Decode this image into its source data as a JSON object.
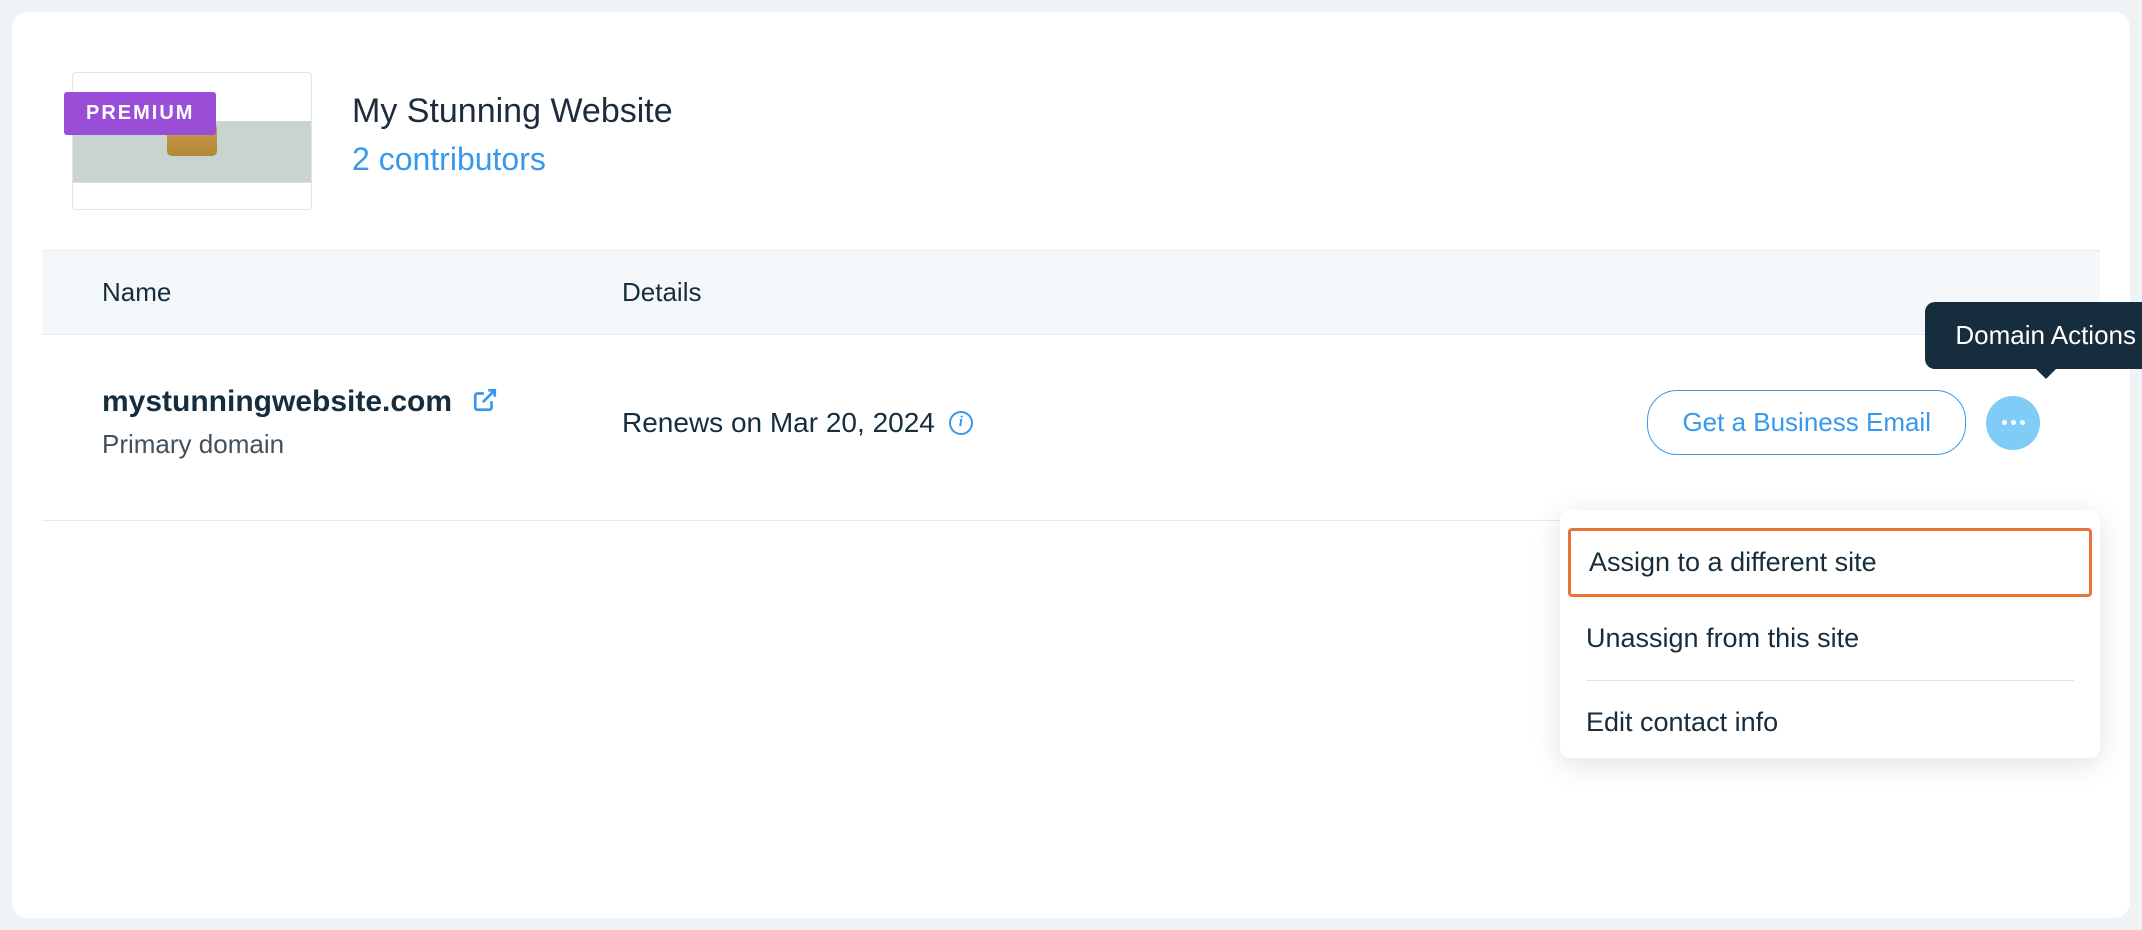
{
  "site": {
    "badge": "PREMIUM",
    "title": "My Stunning Website",
    "contributors_label": "2 contributors"
  },
  "table": {
    "columns": {
      "name": "Name",
      "details": "Details"
    }
  },
  "domain": {
    "name": "mystunningwebsite.com",
    "sublabel": "Primary domain",
    "renew_text": "Renews on Mar 20, 2024",
    "business_email_label": "Get a Business Email"
  },
  "tooltip": {
    "domain_actions": "Domain Actions"
  },
  "menu": {
    "assign": "Assign to a different site",
    "unassign": "Unassign from this site",
    "edit_contact": "Edit contact info"
  }
}
